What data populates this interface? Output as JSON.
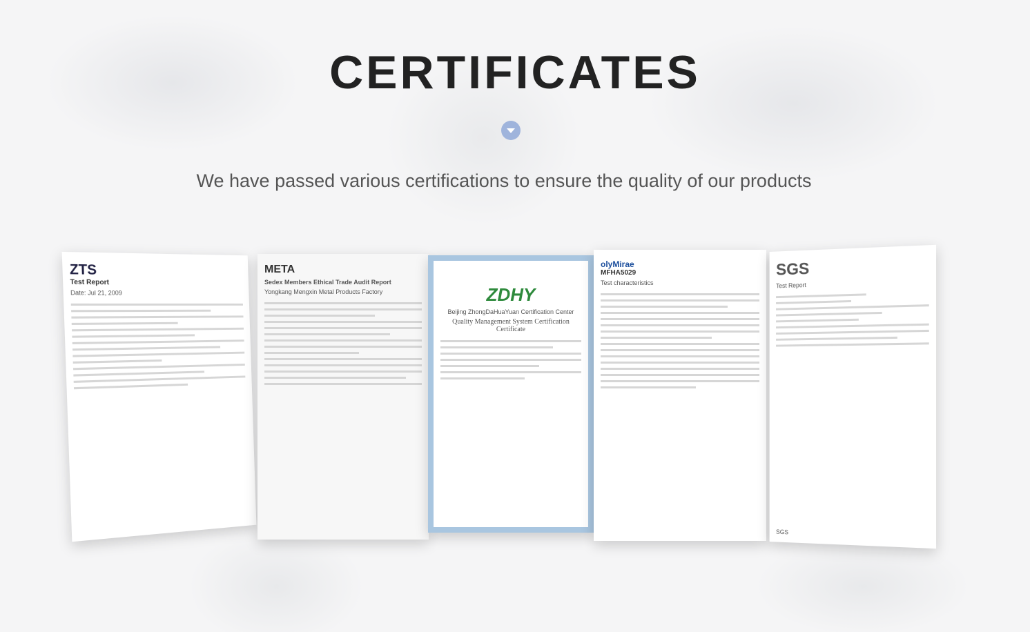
{
  "title": "CERTIFICATES",
  "subtitle": "We have passed various certifications to ensure the quality of our products",
  "scroll_icon": "chevron-down-icon",
  "accent": "#9fb4dc",
  "certificates": [
    {
      "logo": "ZTS",
      "heading": "Test Report",
      "note": "Date: Jul 21, 2009"
    },
    {
      "logo": "META",
      "heading": "Sedex Members Ethical Trade Audit Report",
      "note": "Yongkang Mengxin Metal Products Factory"
    },
    {
      "logo": "ZDHY",
      "heading": "Quality Management System Certification Certificate",
      "note": "Beijing ZhongDaHuaYuan Certification Center"
    },
    {
      "logo": "olyMirae",
      "heading": "MFHA5029",
      "note": "Test characteristics"
    },
    {
      "logo": "SGS",
      "heading": "Test Report",
      "note": "SGS"
    }
  ]
}
